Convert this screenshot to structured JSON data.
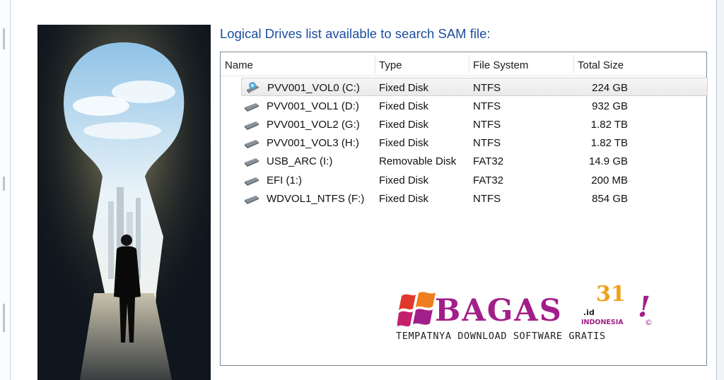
{
  "header": {
    "title": "Logical Drives list available to search SAM file:"
  },
  "columns": [
    {
      "label": "Name"
    },
    {
      "label": "Type"
    },
    {
      "label": "File System"
    },
    {
      "label": "Total Size"
    }
  ],
  "drives": [
    {
      "name": "PVV001_VOL0 (C:)",
      "type": "Fixed Disk",
      "fs": "NTFS",
      "size": "224 GB",
      "selected": true
    },
    {
      "name": "PVV001_VOL1 (D:)",
      "type": "Fixed Disk",
      "fs": "NTFS",
      "size": "932 GB"
    },
    {
      "name": "PVV001_VOL2 (G:)",
      "type": "Fixed Disk",
      "fs": "NTFS",
      "size": "1.82 TB"
    },
    {
      "name": "PVV001_VOL3 (H:)",
      "type": "Fixed Disk",
      "fs": "NTFS",
      "size": "1.82 TB"
    },
    {
      "name": "USB_ARC (I:)",
      "type": "Removable Disk",
      "fs": "FAT32",
      "size": "14.9 GB"
    },
    {
      "name": "EFI (1:)",
      "type": "Fixed Disk",
      "fs": "FAT32",
      "size": "200 MB"
    },
    {
      "name": "WDVOL1_NTFS (F:)",
      "type": "Fixed Disk",
      "fs": "NTFS",
      "size": "854 GB"
    }
  ],
  "watermark": {
    "brand": "BAGAS",
    "number": "31",
    "tld": ".id",
    "country": "INDONESIA",
    "exclaim": "!",
    "copyright": "©",
    "tagline": "TEMPATNYA DOWNLOAD SOFTWARE GRATIS"
  },
  "icons": {
    "drive": "hard-drive-icon",
    "system_drive": "system-drive-icon"
  },
  "colors": {
    "title": "#1b4d9e",
    "brand": "#a21e88",
    "accent": "#f0a019"
  }
}
